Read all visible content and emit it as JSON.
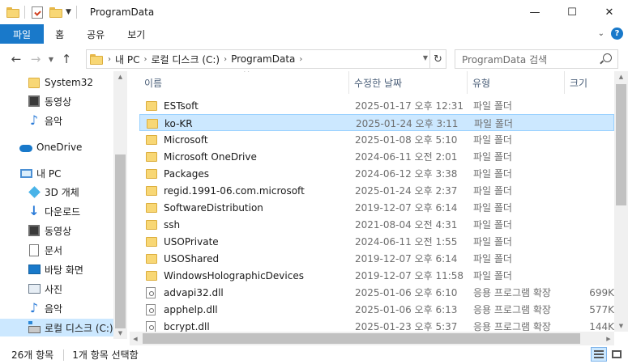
{
  "window": {
    "title": "ProgramData",
    "controls": {
      "minimize": "—",
      "maximize": "☐",
      "close": "✕"
    }
  },
  "ribbon": {
    "tabs": [
      "파일",
      "홈",
      "공유",
      "보기"
    ],
    "collapse_icon": "chevron-down-icon",
    "help_label": "?"
  },
  "address": {
    "crumbs": [
      "내 PC",
      "로컬 디스크 (C:)",
      "ProgramData"
    ],
    "separator": "›",
    "search_placeholder": "ProgramData 검색"
  },
  "nav": {
    "items": [
      {
        "label": "System32",
        "icon": "folder-icon"
      },
      {
        "label": "동영상",
        "icon": "video-icon"
      },
      {
        "label": "음악",
        "icon": "music-icon"
      },
      {
        "label": "OneDrive",
        "icon": "cloud-icon"
      },
      {
        "label": "내 PC",
        "icon": "pc-icon"
      },
      {
        "label": "3D 개체",
        "icon": "3d-objects-icon"
      },
      {
        "label": "다운로드",
        "icon": "download-icon"
      },
      {
        "label": "동영상",
        "icon": "video-icon"
      },
      {
        "label": "문서",
        "icon": "document-icon"
      },
      {
        "label": "바탕 화면",
        "icon": "desktop-icon"
      },
      {
        "label": "사진",
        "icon": "pictures-icon"
      },
      {
        "label": "음악",
        "icon": "music-icon"
      },
      {
        "label": "로컬 디스크 (C:)",
        "icon": "drive-icon",
        "selected": true
      }
    ]
  },
  "columns": {
    "name": "이름",
    "date": "수정한 날짜",
    "type": "유형",
    "size": "크기"
  },
  "files": [
    {
      "name": "ESTsoft",
      "date": "2025-01-17 오후 12:31",
      "type": "파일 폴더",
      "size": "",
      "kind": "folder"
    },
    {
      "name": "ko-KR",
      "date": "2025-01-24 오후 3:11",
      "type": "파일 폴더",
      "size": "",
      "kind": "folder",
      "selected": true
    },
    {
      "name": "Microsoft",
      "date": "2025-01-08 오후 5:10",
      "type": "파일 폴더",
      "size": "",
      "kind": "folder"
    },
    {
      "name": "Microsoft OneDrive",
      "date": "2024-06-11 오전 2:01",
      "type": "파일 폴더",
      "size": "",
      "kind": "folder"
    },
    {
      "name": "Packages",
      "date": "2024-06-12 오후 3:38",
      "type": "파일 폴더",
      "size": "",
      "kind": "folder"
    },
    {
      "name": "regid.1991-06.com.microsoft",
      "date": "2025-01-24 오후 2:37",
      "type": "파일 폴더",
      "size": "",
      "kind": "folder"
    },
    {
      "name": "SoftwareDistribution",
      "date": "2019-12-07 오후 6:14",
      "type": "파일 폴더",
      "size": "",
      "kind": "folder"
    },
    {
      "name": "ssh",
      "date": "2021-08-04 오전 4:31",
      "type": "파일 폴더",
      "size": "",
      "kind": "folder"
    },
    {
      "name": "USOPrivate",
      "date": "2024-06-11 오전 1:55",
      "type": "파일 폴더",
      "size": "",
      "kind": "folder"
    },
    {
      "name": "USOShared",
      "date": "2019-12-07 오후 6:14",
      "type": "파일 폴더",
      "size": "",
      "kind": "folder"
    },
    {
      "name": "WindowsHolographicDevices",
      "date": "2019-12-07 오후 11:58",
      "type": "파일 폴더",
      "size": "",
      "kind": "folder"
    },
    {
      "name": "advapi32.dll",
      "date": "2025-01-06 오후 6:10",
      "type": "응용 프로그램 확장",
      "size": "699K",
      "kind": "dll"
    },
    {
      "name": "apphelp.dll",
      "date": "2025-01-06 오후 6:13",
      "type": "응용 프로그램 확장",
      "size": "577K",
      "kind": "dll"
    },
    {
      "name": "bcrypt.dll",
      "date": "2025-01-23 오후 5:37",
      "type": "응용 프로그램 확장",
      "size": "144K",
      "kind": "dll"
    }
  ],
  "status": {
    "count": "26개 항목",
    "selection": "1개 항목 선택함"
  }
}
